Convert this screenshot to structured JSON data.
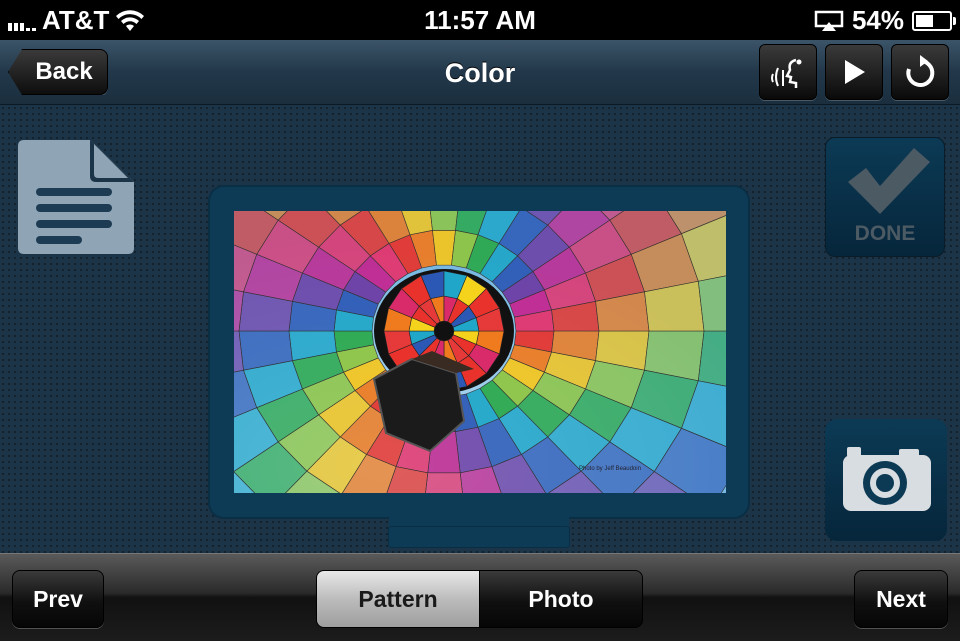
{
  "status_bar": {
    "carrier": "AT&T",
    "time": "11:57 AM",
    "battery_percent": "54%",
    "battery_level": 0.54,
    "icons": [
      "signal-icon",
      "wifi-icon",
      "airplay-icon",
      "battery-icon"
    ]
  },
  "navbar": {
    "back_label": "Back",
    "title": "Color",
    "icons": [
      "voice-icon",
      "play-icon",
      "refresh-icon"
    ]
  },
  "side_buttons": {
    "done_label": "DONE",
    "icons": [
      "document-icon",
      "checkmark-icon",
      "camera-icon"
    ]
  },
  "preview": {
    "image": "hot-air-balloon-photo",
    "caption": "Photo by Jeff Beaudoin"
  },
  "toolbar": {
    "prev_label": "Prev",
    "segments": [
      "Pattern",
      "Photo"
    ],
    "selected_segment": "Pattern",
    "next_label": "Next"
  },
  "colors": {
    "background": "#1c3447",
    "monitor": "#0d3b56",
    "accent_button": "#0c3a55"
  }
}
